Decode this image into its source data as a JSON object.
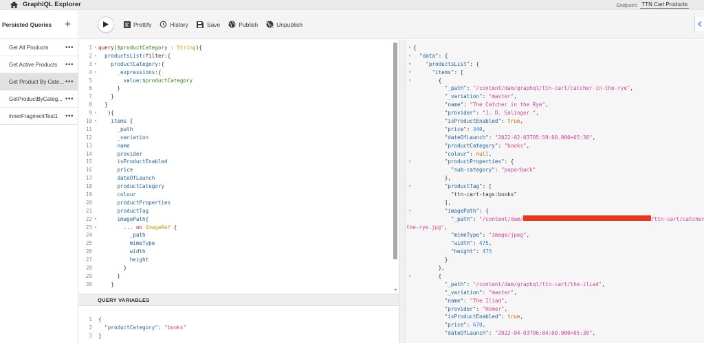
{
  "app": {
    "title": "GraphiQL Explorer",
    "endpoint_label": "Endpoint",
    "endpoint_value": "TTN Cart Products"
  },
  "sidebar": {
    "title": "Persisted Queries",
    "items": [
      {
        "label": "Get All Products",
        "selected": false
      },
      {
        "label": "Get Active Products",
        "selected": false
      },
      {
        "label": "Get Product By Cate...",
        "selected": true
      },
      {
        "label": "GetProductByCateg...",
        "selected": false
      },
      {
        "label": "innerFragmentTest1",
        "selected": false
      }
    ]
  },
  "toolbar": {
    "prettify": "Prettify",
    "history": "History",
    "save": "Save",
    "publish": "Publish",
    "unpublish": "Unpublish"
  },
  "query_variables": {
    "title": "QUERY VARIABLES",
    "lines": [
      "{",
      "  \"productCategory\": \"books\"",
      "}"
    ]
  },
  "editor_lines": [
    "query($productCategory : String){",
    "  productsList(filter:{",
    "    productCategory:{",
    "      _expressions:{",
    "        value:$productCategory",
    "      }",
    "    }",
    "  }",
    "   ){",
    "    items {",
    "      _path",
    "      _variation",
    "      name",
    "      provider",
    "      isProductEnabled",
    "      price",
    "      dateOfLaunch",
    "      productCategory",
    "      colour",
    "      productProperties",
    "      productTag",
    "      imagePath{",
    "        ... on ImageRef {",
    "          _path",
    "          mimeType",
    "          width",
    "          height",
    "        }",
    "      }",
    "    }"
  ],
  "result_lines": [
    "{",
    "  \"data\": {",
    "    \"productsList\": {",
    "      \"items\": [",
    "        {",
    "          \"_path\": \"/content/dam/graphql/ttn-cart/catcher-in-the-rye\",",
    "          \"_variation\": \"master\",",
    "          \"name\": \"The Catcher in the Rye\",",
    "          \"provider\": \"J. D. Salinger \",",
    "          \"isProductEnabled\": true,",
    "          \"price\": 340,",
    "          \"dateOfLaunch\": \"2022-02-03T05:59:00.000+05:30\",",
    "          \"productCategory\": \"books\",",
    "          \"colour\": null,",
    "          \"productProperties\": {",
    "            \"sub-category\": \"paperback\"",
    "          },",
    "          \"productTag\": [",
    "            \"ttn-cart-tags:books\"",
    "          ],",
    "          \"imagePath\": {",
    "            \"_path\": \"/content/dam/",
    "the-rye.jpg\",",
    "            \"mimeType\": \"image/jpeg\",",
    "            \"width\": 475,",
    "            \"height\": 475",
    "          }",
    "        },",
    "        {",
    "          \"_path\": \"/content/dam/graphql/ttn-cart/the-iliad\",",
    "          \"_variation\": \"master\",",
    "          \"name\": \"The Iliad\",",
    "          \"provider\": \"Homer\",",
    "          \"isProductEnabled\": true,",
    "          \"price\": 670,",
    "          \"dateOfLaunch\": \"2022-04-03T06:04:00.000+05:30\","
  ],
  "result_redacted_suffix": "/ttn-cart/catcher-in",
  "colors": {
    "redaction": "#e8361f",
    "accent": "#1473e6"
  }
}
